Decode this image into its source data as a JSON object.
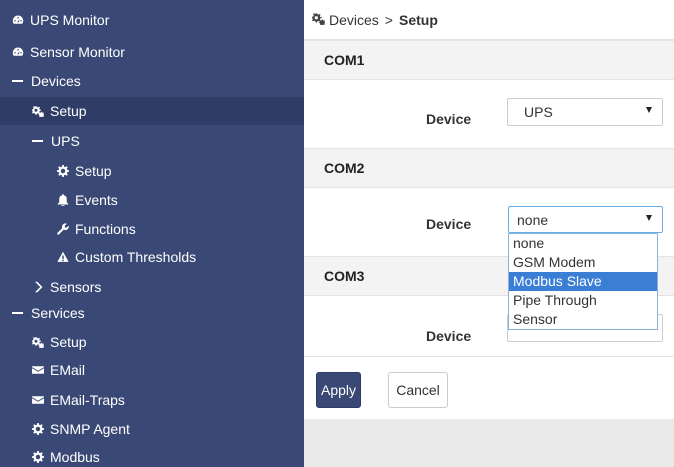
{
  "sidebar": {
    "items": [
      {
        "label": "UPS Monitor",
        "icon": "dashboard-icon"
      },
      {
        "label": "Sensor Monitor",
        "icon": "dashboard-icon"
      },
      {
        "label": "Devices",
        "icon": "collapse-dash"
      },
      {
        "label": "Setup",
        "icon": "cogs-icon",
        "active": true
      },
      {
        "label": "UPS",
        "icon": "collapse-dash"
      },
      {
        "label": "Setup",
        "icon": "gear-icon"
      },
      {
        "label": "Events",
        "icon": "bell-icon"
      },
      {
        "label": "Functions",
        "icon": "wrench-icon"
      },
      {
        "label": "Custom Thresholds",
        "icon": "warning-icon"
      },
      {
        "label": "Sensors",
        "icon": "chevron-right-icon"
      },
      {
        "label": "Services",
        "icon": "collapse-dash"
      },
      {
        "label": "Setup",
        "icon": "cogs-icon"
      },
      {
        "label": "EMail",
        "icon": "envelope-icon"
      },
      {
        "label": "EMail-Traps",
        "icon": "envelope-icon"
      },
      {
        "label": "SNMP Agent",
        "icon": "gear-icon"
      },
      {
        "label": "Modbus",
        "icon": "gear-icon"
      }
    ]
  },
  "breadcrumb": {
    "parent": "Devices",
    "separator": ">",
    "current": "Setup"
  },
  "sections": [
    {
      "title": "COM1",
      "device_label": "Device",
      "selected": "UPS"
    },
    {
      "title": "COM2",
      "device_label": "Device",
      "selected": "none"
    },
    {
      "title": "COM3",
      "device_label": "Device",
      "selected": ""
    }
  ],
  "dropdown": {
    "options": [
      "none",
      "GSM Modem",
      "Modbus Slave",
      "Pipe Through",
      "Sensor"
    ],
    "highlighted": "Modbus Slave"
  },
  "buttons": {
    "apply": "Apply",
    "cancel": "Cancel"
  },
  "colors": {
    "sidebar_bg": "#3a4876",
    "active_bg": "#2f3c66",
    "highlight": "#3b7ed6"
  }
}
